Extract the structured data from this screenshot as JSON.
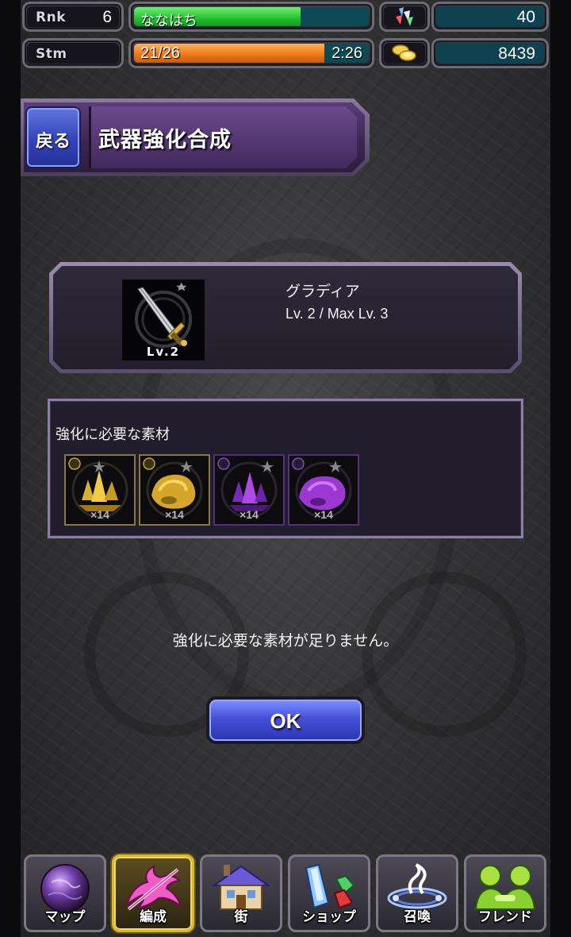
{
  "status": {
    "rank": {
      "tag": "Rnk",
      "value": "6",
      "name": "ななはち",
      "exp_fraction": 0.71
    },
    "stamina": {
      "tag": "Stm",
      "value": "21/26",
      "timer": "2:26",
      "fraction": 0.81
    },
    "gems": "40",
    "gold": "8439"
  },
  "header": {
    "back_label": "戻る",
    "title": "武器強化合成"
  },
  "weapon": {
    "name": "グラディア",
    "level_text": "Lv. 2 / Max Lv. 3",
    "badge": "Lv.2"
  },
  "materials": {
    "label": "強化に必要な素材",
    "items": [
      {
        "icon": "gold-crystal-icon",
        "qty": "×14",
        "color": "#e2b83a"
      },
      {
        "icon": "gold-ore-icon",
        "qty": "×14",
        "color": "#e2b83a"
      },
      {
        "icon": "purple-crystal-icon",
        "qty": "×14",
        "color": "#9b3ad6"
      },
      {
        "icon": "purple-ore-icon",
        "qty": "×14",
        "color": "#9b3ad6"
      }
    ]
  },
  "message": "強化に必要な素材が足りません。",
  "ok_label": "OK",
  "nav": [
    {
      "label": "マップ",
      "icon": "map-orb-icon"
    },
    {
      "label": "編成",
      "icon": "dragon-icon"
    },
    {
      "label": "街",
      "icon": "house-icon"
    },
    {
      "label": "ショップ",
      "icon": "crystal-shop-icon"
    },
    {
      "label": "召喚",
      "icon": "summon-icon"
    },
    {
      "label": "フレンド",
      "icon": "friends-icon"
    }
  ]
}
